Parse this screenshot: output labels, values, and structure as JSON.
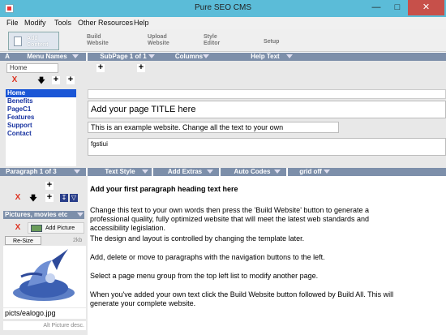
{
  "window": {
    "title": "Pure SEO CMS"
  },
  "menu": [
    "File",
    "Modify",
    "Tools",
    "Other Resources",
    "Help"
  ],
  "toolbar": {
    "add_content": [
      "Add",
      "Content"
    ],
    "build_website": [
      "Build",
      "Website"
    ],
    "upload_website": [
      "Upload",
      "Website"
    ],
    "style_editor": [
      "Style",
      "Editor"
    ],
    "setup": "Setup"
  },
  "headers": {
    "a": "A",
    "menu_names": "Menu Names",
    "subpage": "SubPage 1 of 1",
    "columns": "Columns",
    "help_text": "Help Text",
    "paragraph": "Paragraph 1 of 3",
    "text_style": "Text Style",
    "add_extras": "Add Extras",
    "auto_codes": "Auto Codes",
    "grid_off": "grid off"
  },
  "menu_group": {
    "value": "Home"
  },
  "pages": [
    "Home",
    "Benefits",
    "PageC1",
    "Features",
    "Support",
    "Contact"
  ],
  "selected_page_index": 0,
  "page": {
    "title": "Add your page TITLE here",
    "description": "This is an example website. Change all the text to your own",
    "keywords": "fgstiui"
  },
  "pictures": {
    "header": "Pictures, movies etc",
    "add_picture": "Add Picture",
    "resize": "Re-Size",
    "size": "2kb",
    "filename": "picts/ealogo.jpg",
    "alt_placeholder": "Alt Picture desc."
  },
  "paragraph": {
    "heading": "Add your first paragraph heading text here",
    "body": [
      "Change this text to your own words then press the 'Build Website' button to generate a professional quality,  fully optimized website that will meet the latest web standards and accessibility legislation.",
      "The design and layout is controlled by changing the template later.",
      "Add, delete or move to paragraphs with the navigation buttons to the left.",
      "Select a page menu group from the top left list to modify another page.",
      "When you've added your own text click the Build Website button followed by Build All. This will generate your complete website."
    ]
  },
  "icons": {
    "plus": "+",
    "delete": "X",
    "down": "🡇",
    "up": "🡅"
  }
}
